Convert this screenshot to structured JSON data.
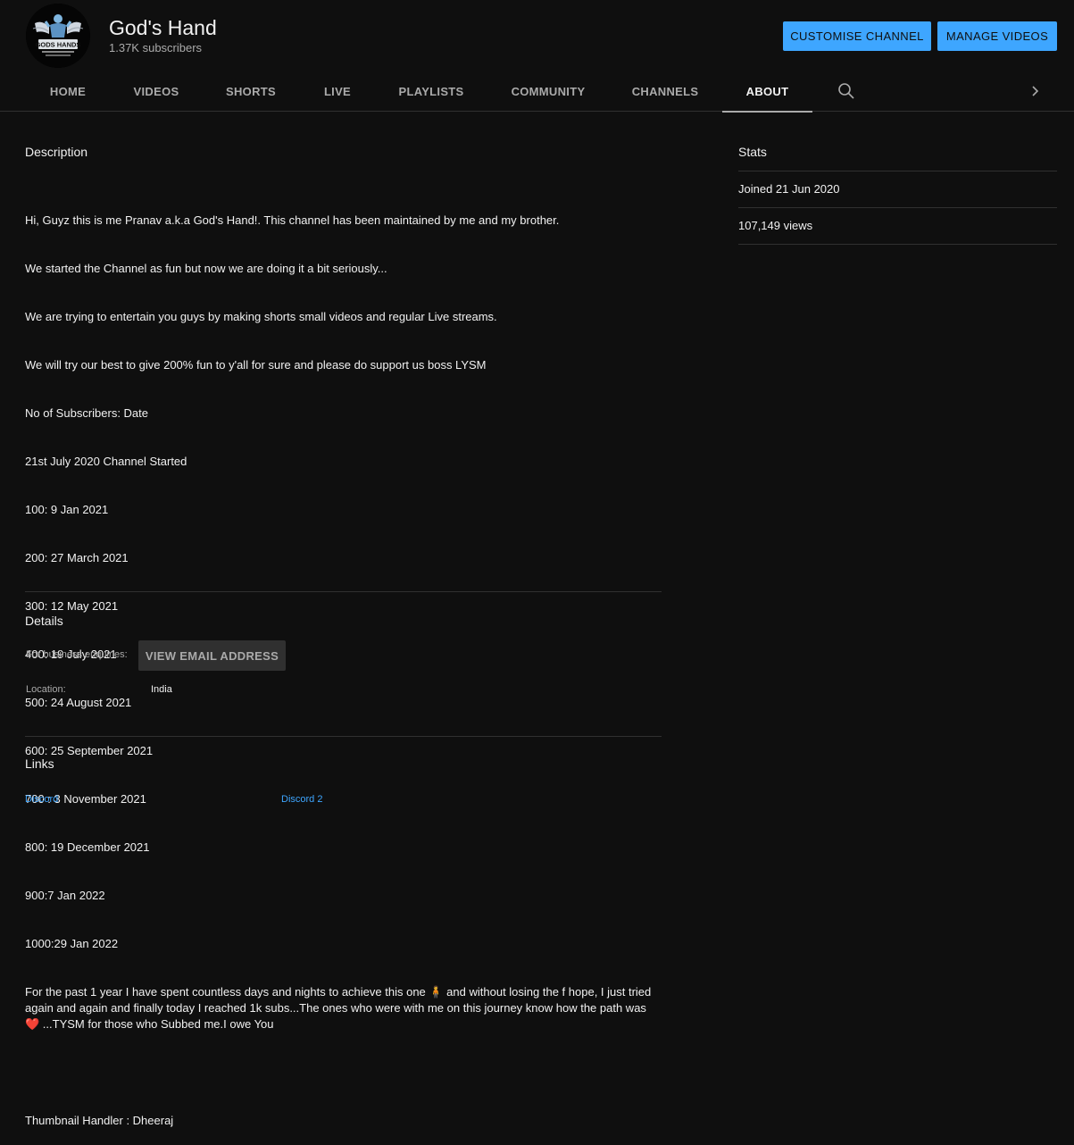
{
  "channel": {
    "name": "God's Hand",
    "subscribers": "1.37K subscribers",
    "avatar_text": "GODS HANDS"
  },
  "header_buttons": {
    "customise": "CUSTOMISE CHANNEL",
    "manage": "MANAGE VIDEOS"
  },
  "tabs": [
    {
      "label": "HOME"
    },
    {
      "label": "VIDEOS"
    },
    {
      "label": "SHORTS"
    },
    {
      "label": "LIVE"
    },
    {
      "label": "PLAYLISTS"
    },
    {
      "label": "COMMUNITY"
    },
    {
      "label": "CHANNELS"
    },
    {
      "label": "ABOUT"
    }
  ],
  "active_tab": "ABOUT",
  "description": {
    "title": "Description",
    "lines": [
      "Hi, Guyz this is me Pranav a.k.a God's Hand!. This channel has been maintained by me and my brother.",
      "We started the Channel as fun but now we are doing it a bit seriously...",
      "We are trying to entertain you guys by making shorts small videos and regular Live streams.",
      "We will try our best to give 200% fun to y'all for sure and please do support us boss LYSM",
      "No of Subscribers: Date",
      "21st July 2020 Channel Started",
      "100: 9 Jan 2021",
      "200: 27 March 2021",
      "300: 12 May 2021",
      "400: 19 July 2021",
      "500: 24 August 2021",
      "600: 25 September 2021",
      "700 : 3 November 2021",
      "800: 19 December 2021",
      "900:7 Jan 2022",
      "1000:29 Jan 2022",
      "For the past 1 year I have spent countless days and nights to achieve this one 🧍 and without losing the f hope, I just tried again and again and finally today I reached 1k subs...The ones who were with me on this journey know how the path was ❤️ ...TYSM for those who Subbed me.I owe You",
      "",
      "Thumbnail Handler : Dheeraj"
    ]
  },
  "details": {
    "title": "Details",
    "business_label": "For business enquiries:",
    "email_button": "VIEW EMAIL ADDRESS",
    "location_label": "Location:",
    "location_value": "India"
  },
  "links": {
    "title": "Links",
    "items": [
      {
        "label": "Discord"
      },
      {
        "label": "Discord 2"
      }
    ]
  },
  "stats": {
    "title": "Stats",
    "joined": "Joined 21 Jun 2020",
    "views": "107,149 views"
  },
  "colors": {
    "background": "#0f0f0f",
    "accent_blue": "#3ea6ff",
    "text_primary": "#f1f1f1",
    "text_secondary": "#aaaaaa",
    "divider": "#303030"
  }
}
